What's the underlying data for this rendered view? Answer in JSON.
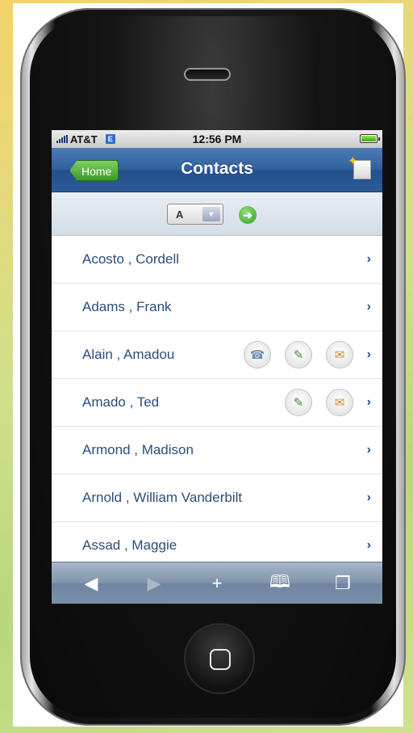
{
  "statusbar": {
    "carrier": "AT&T",
    "network": "E",
    "time": "12:56 PM"
  },
  "navbar": {
    "back_label": "Home",
    "title": "Contacts",
    "new_icon": "new-contact-icon"
  },
  "filter": {
    "selected_letter": "A",
    "dropdown_icon": "chevron-down-icon",
    "go_icon": "go-arrow-icon"
  },
  "contacts": [
    {
      "name": "Acosto , Cordell",
      "actions": []
    },
    {
      "name": "Adams , Frank",
      "actions": []
    },
    {
      "name": "Alain , Amadou",
      "actions": [
        "phone",
        "sms",
        "email"
      ]
    },
    {
      "name": "Amado , Ted",
      "actions": [
        "sms",
        "email"
      ]
    },
    {
      "name": "Armond , Madison",
      "actions": []
    },
    {
      "name": "Arnold , William Vanderbilt",
      "actions": []
    },
    {
      "name": "Assad , Maggie",
      "actions": []
    }
  ],
  "toolbar": {
    "items": [
      "back-icon",
      "forward-icon",
      "add-icon",
      "bookmarks-icon",
      "pages-icon"
    ]
  },
  "colors": {
    "nav_blue": "#2f5f9e",
    "home_green": "#3a9a2a",
    "name_text": "#2a4f7a"
  }
}
